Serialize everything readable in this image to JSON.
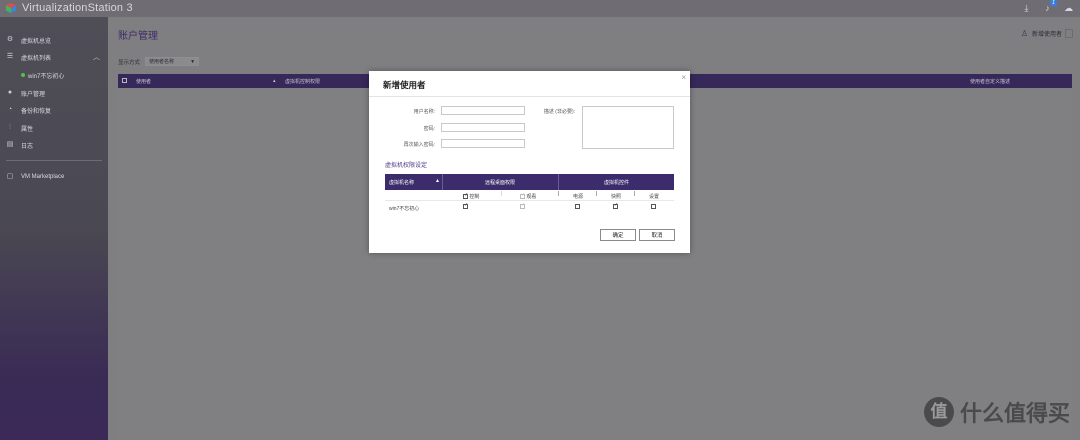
{
  "app": {
    "title": "VirtualizationStation 3"
  },
  "topbar": {
    "icons": [
      "download-icon",
      "bell-icon",
      "cloud-icon"
    ],
    "notification_count": "1"
  },
  "sidebar": {
    "items": [
      {
        "label": "虚拟机总览",
        "icon": "grid-icon"
      },
      {
        "label": "虚拟机列表",
        "icon": "list-icon"
      },
      {
        "label": "win7不忘初心",
        "icon": "status-dot"
      },
      {
        "label": "账户管理",
        "icon": "user-icon"
      },
      {
        "label": "备份和恢复",
        "icon": "backup-icon"
      },
      {
        "label": "属性",
        "icon": "sliders-icon"
      },
      {
        "label": "日志",
        "icon": "log-icon"
      },
      {
        "label": "VM Marketplace",
        "icon": "market-icon"
      }
    ]
  },
  "main": {
    "title": "账户管理",
    "add_user_label": "新增使用者",
    "display_mode_label": "显示方式",
    "display_mode_value": "使用者名称",
    "table_headers": [
      "使用者",
      "虚拟机控制权限",
      "使用者自定义描述"
    ]
  },
  "modal": {
    "title": "新增使用者",
    "fields": {
      "username_label": "用户名称:",
      "password_label": "密码:",
      "confirm_label": "再次输入密码:",
      "description_label": "描述 (非必要):"
    },
    "section_title": "虚拟机权限设定",
    "perm_headers": {
      "vm_name": "虚拟机名称",
      "remote": "远程桌面权限",
      "control": "虚拟机控件"
    },
    "sub_headers": [
      "控制",
      "观看",
      "电源",
      "快照",
      "设置"
    ],
    "rows": [
      {
        "name": "win7不忘初心",
        "control": true,
        "view": true,
        "power": false,
        "snapshot": true,
        "settings": false
      }
    ],
    "ok_label": "确定",
    "cancel_label": "取消"
  },
  "watermark": {
    "badge": "值",
    "text": "什么值得买"
  }
}
